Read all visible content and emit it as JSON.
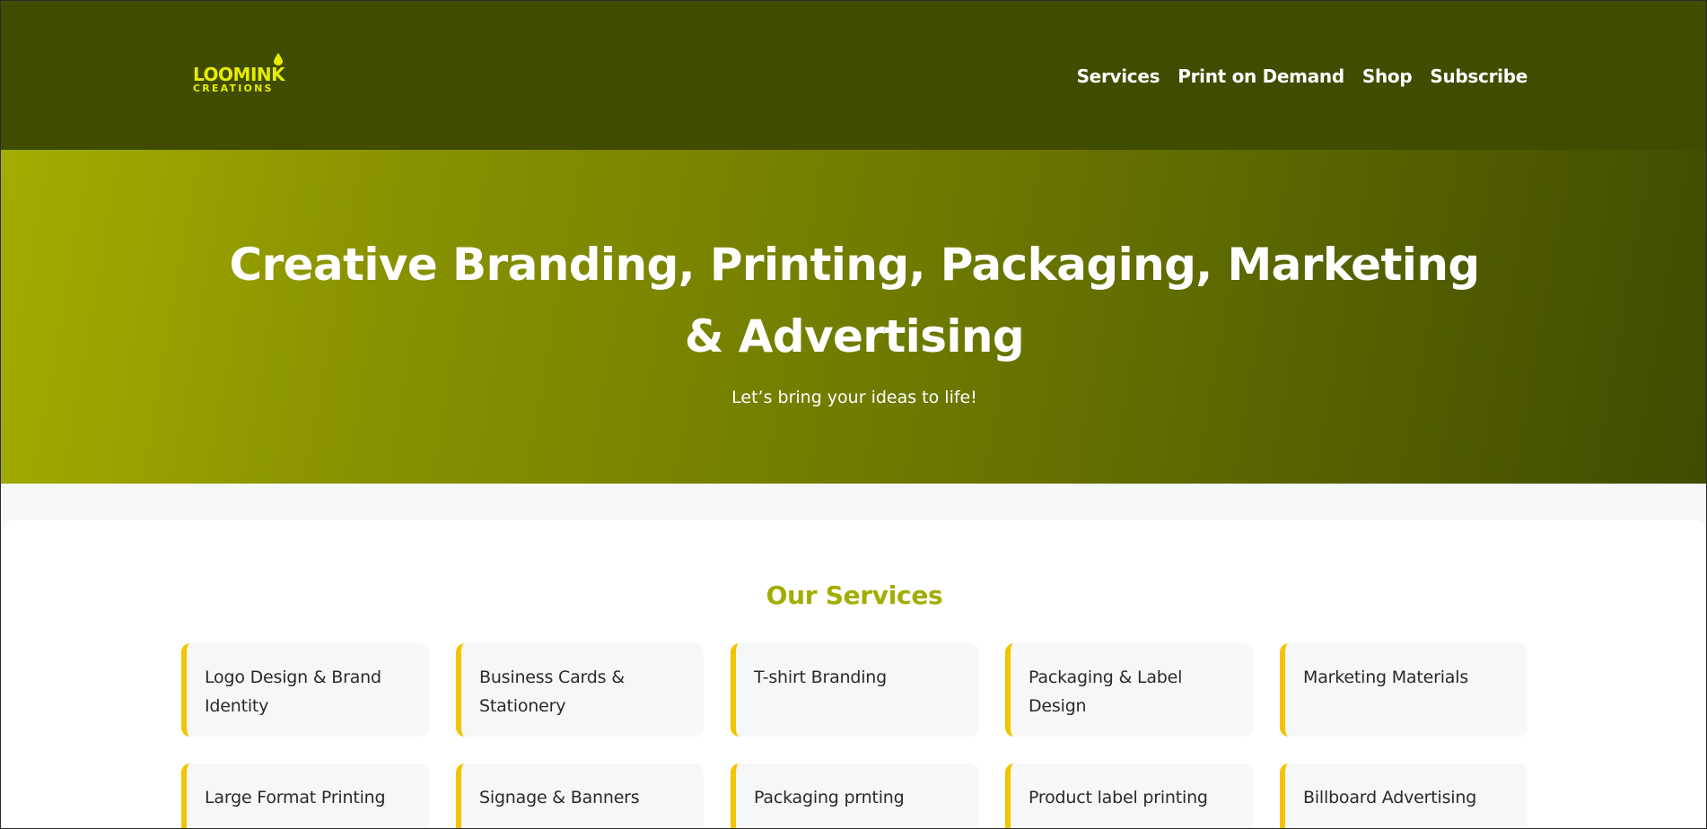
{
  "brand": {
    "logo_line1": "LOOMINK",
    "logo_line2": "CREATIONS",
    "logo_color": "#e6ec00"
  },
  "nav": {
    "items": [
      {
        "label": "Services"
      },
      {
        "label": "Print on Demand"
      },
      {
        "label": "Shop"
      },
      {
        "label": "Subscribe"
      }
    ]
  },
  "hero": {
    "title": "Creative Branding, Printing, Packaging, Marketing & Advertising",
    "subtitle": "Let’s bring your ideas to life!"
  },
  "services": {
    "title": "Our Services",
    "accent_color": "#f2c500",
    "items": [
      {
        "label": "Logo Design & Brand Identity"
      },
      {
        "label": "Business Cards & Stationery"
      },
      {
        "label": "T-shirt Branding"
      },
      {
        "label": "Packaging & Label Design"
      },
      {
        "label": "Marketing Materials"
      },
      {
        "label": "Large Format Printing"
      },
      {
        "label": "Signage & Banners"
      },
      {
        "label": "Packaging prnting"
      },
      {
        "label": "Product label printing"
      },
      {
        "label": "Billboard Advertising"
      }
    ]
  },
  "colors": {
    "header_bg": "#404c00",
    "hero_gradient_start": "#a2ad00",
    "hero_gradient_end": "#404c00",
    "section_title": "#a3ad00"
  }
}
